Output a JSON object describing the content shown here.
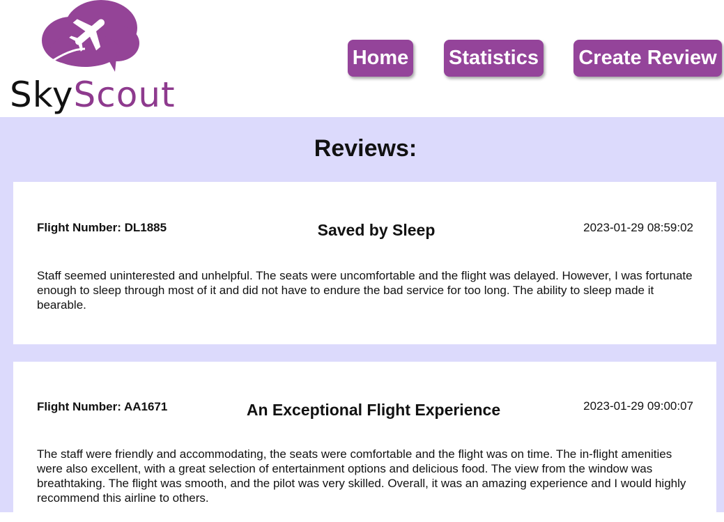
{
  "brand": {
    "name_part1": "Sky",
    "name_part2": "Scout",
    "accent_color": "#94449a",
    "logo_icon": "airplane-cloud-icon"
  },
  "nav": {
    "home": "Home",
    "statistics": "Statistics",
    "create_review": "Create Review"
  },
  "page": {
    "heading": "Reviews:",
    "background_color": "#dcdafc"
  },
  "reviews": [
    {
      "flight_number": "Flight Number: DL1885",
      "title": "Saved by Sleep",
      "date": "2023-01-29 08:59:02",
      "body": "Staff seemed uninterested and unhelpful. The seats were uncomfortable and the flight was delayed. However, I was fortunate enough to sleep through most of it and did not have to endure the bad service for too long. The ability to sleep made it bearable."
    },
    {
      "flight_number": "Flight Number: AA1671",
      "title": "An Exceptional Flight Experience",
      "date": "2023-01-29 09:00:07",
      "body": "The staff were friendly and accommodating, the seats were comfortable and the flight was on time. The in-flight amenities were also excellent, with a great selection of entertainment options and delicious food. The view from the window was breathtaking. The flight was smooth, and the pilot was very skilled. Overall, it was an amazing experience and I would highly recommend this airline to others."
    }
  ]
}
